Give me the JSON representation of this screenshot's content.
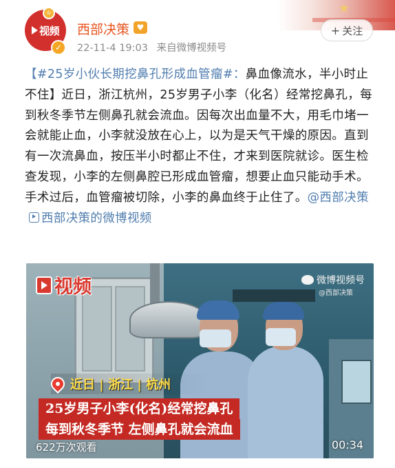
{
  "header": {
    "username": "西部决策",
    "timestamp": "22-11-4 19:03",
    "source": "来自微博视频号",
    "follow_label": "关注",
    "avatar_text": "视频"
  },
  "post": {
    "hashtag": "【#25岁小伙长期挖鼻孔形成血管瘤#：",
    "body": "鼻血像流水，半小时止不住】近日，浙江杭州，25岁男子小李（化名）经常挖鼻孔，每到秋冬季节左侧鼻孔就会流血。因每次出血量不大，用毛巾堵一会就能止血，小李就没放在心上，以为是天气干燥的原因。直到有一次流鼻血，按压半小时都止不住，才来到医院就诊。医生检查发现，小李的左侧鼻腔已形成血管瘤，想要止血只能动手术。手术过后，血管瘤被切除，小李的鼻血终于止住了。",
    "mention": "@西部决策",
    "video_link": "西部决策的微博视频"
  },
  "video": {
    "logo_text": "视频",
    "watermark": "微博视频号",
    "watermark_sub": "@西部决策",
    "location": "近日 | 浙江 | 杭州",
    "caption_line1": "25岁男子小李(化名)经常挖鼻孔",
    "caption_line2": "每到秋冬季节  左侧鼻孔就会流血",
    "views": "622万次观看",
    "duration": "00:34"
  },
  "colors": {
    "username": "#e8541e",
    "link": "#507daf",
    "brand_red": "#d2302d",
    "caption_bg": "#c42a23",
    "location_text": "#ffde4a"
  },
  "icons": [
    "avatar-play-icon",
    "verified-icon",
    "vip-badge-icon",
    "plus-icon",
    "video-link-icon",
    "weibo-icon",
    "location-pin-icon"
  ]
}
